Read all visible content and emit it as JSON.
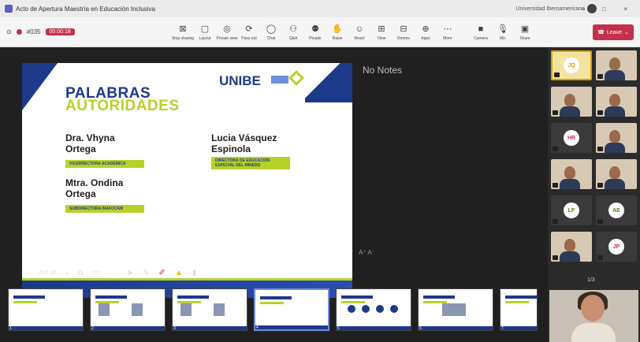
{
  "window": {
    "title": "Acto de Apertura Maestría en Educación Inclusiva",
    "org": "Universidad Iberoamericana",
    "controls": "– □ ×"
  },
  "toolbar": {
    "timer": "00:00:18",
    "meeting_code": "#035",
    "tools": [
      {
        "icon": "⊠",
        "label": "Stop sharing"
      },
      {
        "icon": "▢",
        "label": "Layout"
      },
      {
        "icon": "◎",
        "label": "Private view"
      },
      {
        "icon": "⟳",
        "label": "Pass out"
      },
      {
        "icon": "◯",
        "label": "Chat"
      },
      {
        "icon": "⚇",
        "label": "Q&A"
      },
      {
        "icon": "⚉",
        "label": "People"
      },
      {
        "icon": "✋",
        "label": "Raise"
      },
      {
        "icon": "☺",
        "label": "React"
      },
      {
        "icon": "⊞",
        "label": "View"
      },
      {
        "icon": "⊟",
        "label": "Rooms"
      },
      {
        "icon": "⊕",
        "label": "Apps"
      },
      {
        "icon": "⋯",
        "label": "More"
      },
      {
        "icon": "■",
        "label": "Camera"
      },
      {
        "icon": "🎙",
        "label": "Mic"
      },
      {
        "icon": "▣",
        "label": "Share"
      }
    ],
    "leave_label": "Leave"
  },
  "slide": {
    "title_line1": "PALABRAS",
    "title_line2": "AUTORIDADES",
    "logo": "UNIBE",
    "people": [
      {
        "name_line1": "Dra. Vhyna",
        "name_line2": "Ortega",
        "role": "VICERRECTORA ACADÉMICA"
      },
      {
        "name_line1": "Mtra. Ondina",
        "name_line2": "Ortega",
        "role": "SUBDIRECTORA INAFOCAM"
      },
      {
        "name_line1": "Lucia Vásquez",
        "name_line2": "Espinola",
        "role": "DIRECTORA DE EDUCACIÓN ESPECIAL DEL MINERD"
      }
    ]
  },
  "notes": {
    "text": "No Notes"
  },
  "controls": {
    "page_indicator": "4 of 10"
  },
  "thumbnails": [
    {
      "num": "1",
      "title": "Maestría en Educación Inclusiva"
    },
    {
      "num": "2",
      "title": "UNIBE"
    },
    {
      "num": "3",
      "title": ""
    },
    {
      "num": "4",
      "title": ""
    },
    {
      "num": "5",
      "title": ""
    },
    {
      "num": "6",
      "title": ""
    },
    {
      "num": "7",
      "title": ""
    }
  ],
  "participants": [
    {
      "initials": "JQ",
      "color": "#e0a100",
      "speaking": true
    },
    {
      "initials": "",
      "video": true
    },
    {
      "initials": "",
      "video": true
    },
    {
      "initials": "",
      "video": true
    },
    {
      "initials": "HR",
      "color": "#c4314b"
    },
    {
      "initials": "",
      "video": true
    },
    {
      "initials": "",
      "video": true
    },
    {
      "initials": "",
      "video": true
    },
    {
      "initials": "LF",
      "color": "#498205"
    },
    {
      "initials": "AE",
      "color": "#498205"
    },
    {
      "initials": "",
      "video": true
    },
    {
      "initials": "JP",
      "color": "#c4314b"
    }
  ],
  "roster_pager": "1/3"
}
